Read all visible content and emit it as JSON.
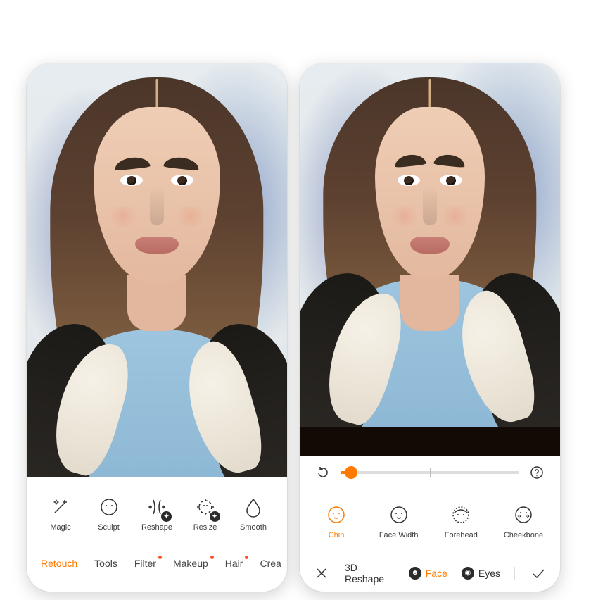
{
  "phone1": {
    "tools": [
      {
        "id": "magic",
        "label": "Magic",
        "badge": false
      },
      {
        "id": "sculpt",
        "label": "Sculpt",
        "badge": false
      },
      {
        "id": "reshape",
        "label": "Reshape",
        "badge": true
      },
      {
        "id": "resize",
        "label": "Resize",
        "badge": true
      },
      {
        "id": "smooth",
        "label": "Smooth",
        "badge": false
      }
    ],
    "tabs": [
      {
        "id": "retouch",
        "label": "Retouch",
        "active": true,
        "dot": false
      },
      {
        "id": "tools",
        "label": "Tools",
        "active": false,
        "dot": false
      },
      {
        "id": "filter",
        "label": "Filter",
        "active": false,
        "dot": true
      },
      {
        "id": "makeup",
        "label": "Makeup",
        "active": false,
        "dot": true
      },
      {
        "id": "hair",
        "label": "Hair",
        "active": false,
        "dot": true
      },
      {
        "id": "create",
        "label": "Crea",
        "active": false,
        "dot": false
      }
    ]
  },
  "phone2": {
    "slider": {
      "reset_icon": "reset",
      "help_icon": "help",
      "value_pct": 6
    },
    "options": [
      {
        "id": "chin",
        "label": "Chin",
        "active": true
      },
      {
        "id": "facewidth",
        "label": "Face Width",
        "active": false
      },
      {
        "id": "forehead",
        "label": "Forehead",
        "active": false
      },
      {
        "id": "cheekbone",
        "label": "Cheekbone",
        "active": false
      }
    ],
    "confirm": {
      "cancel_icon": "close",
      "title": "3D Reshape",
      "chips": [
        {
          "id": "face",
          "label": "Face",
          "active": true
        },
        {
          "id": "eyes",
          "label": "Eyes",
          "active": false
        }
      ],
      "ok_icon": "check"
    }
  },
  "colors": {
    "accent": "#ff7a00"
  }
}
